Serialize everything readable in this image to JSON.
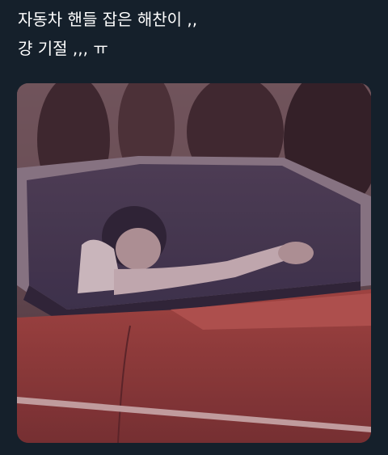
{
  "tweet": {
    "lines": [
      "자동차 핸들 잡은 해찬이 ,,",
      "걍 기절 ,,, ㅠ"
    ]
  },
  "media": {
    "photo_icon": "car-photo-image"
  },
  "colors": {
    "background": "#15202b",
    "text": "#ffffff"
  }
}
